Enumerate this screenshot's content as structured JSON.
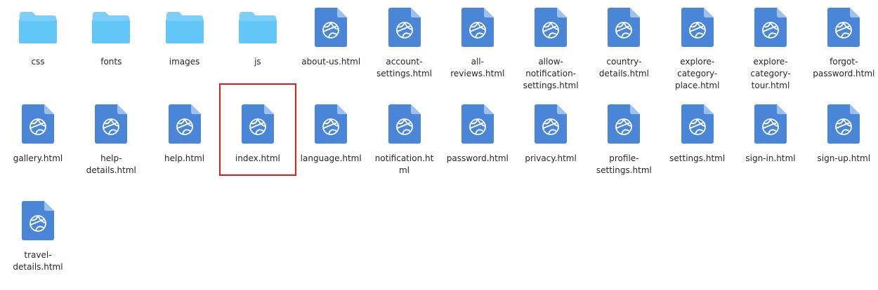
{
  "highlight_color": "#e01b1b",
  "folder_color": "#63c6f8",
  "file_color": "#4a86d8",
  "items": [
    {
      "label": "css",
      "type": "folder",
      "icon": "folder-icon"
    },
    {
      "label": "fonts",
      "type": "folder",
      "icon": "folder-icon"
    },
    {
      "label": "images",
      "type": "folder",
      "icon": "folder-icon"
    },
    {
      "label": "js",
      "type": "folder",
      "icon": "folder-icon"
    },
    {
      "label": "about-us.html",
      "type": "html",
      "icon": "html-file-icon"
    },
    {
      "label": "account-\nsettings.html",
      "type": "html",
      "icon": "html-file-icon"
    },
    {
      "label": "all-\nreviews.html",
      "type": "html",
      "icon": "html-file-icon"
    },
    {
      "label": "allow-\nnotification-\nsettings.html",
      "type": "html",
      "icon": "html-file-icon"
    },
    {
      "label": "country-\ndetails.html",
      "type": "html",
      "icon": "html-file-icon"
    },
    {
      "label": "explore-\ncategory-\nplace.html",
      "type": "html",
      "icon": "html-file-icon"
    },
    {
      "label": "explore-\ncategory-\ntour.html",
      "type": "html",
      "icon": "html-file-icon"
    },
    {
      "label": "forgot-\npassword.html",
      "type": "html",
      "icon": "html-file-icon"
    },
    {
      "label": "gallery.html",
      "type": "html",
      "icon": "html-file-icon"
    },
    {
      "label": "help-\ndetails.html",
      "type": "html",
      "icon": "html-file-icon"
    },
    {
      "label": "help.html",
      "type": "html",
      "icon": "html-file-icon"
    },
    {
      "label": "index.html",
      "type": "html",
      "icon": "html-file-icon",
      "highlighted": true
    },
    {
      "label": "language.html",
      "type": "html",
      "icon": "html-file-icon"
    },
    {
      "label": "notification.ht\nml",
      "type": "html",
      "icon": "html-file-icon"
    },
    {
      "label": "password.html",
      "type": "html",
      "icon": "html-file-icon"
    },
    {
      "label": "privacy.html",
      "type": "html",
      "icon": "html-file-icon"
    },
    {
      "label": "profile-\nsettings.html",
      "type": "html",
      "icon": "html-file-icon"
    },
    {
      "label": "settings.html",
      "type": "html",
      "icon": "html-file-icon"
    },
    {
      "label": "sign-in.html",
      "type": "html",
      "icon": "html-file-icon"
    },
    {
      "label": "sign-up.html",
      "type": "html",
      "icon": "html-file-icon"
    },
    {
      "label": "travel-\ndetails.html",
      "type": "html",
      "icon": "html-file-icon"
    }
  ]
}
